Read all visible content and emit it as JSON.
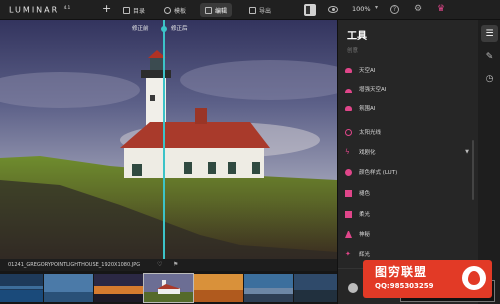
{
  "app": {
    "brand": "LUMINAR",
    "brand_version": "4.1"
  },
  "topbar": {
    "add_icon": "plus-icon",
    "catalog_label": "目录",
    "templates_label": "模板",
    "edit_label": "编辑",
    "export_label": "导出",
    "zoom_label": "100%",
    "help_label": "?"
  },
  "canvas": {
    "before_label": "修正前",
    "after_label": "修正后",
    "split_color": "#3cc3c8"
  },
  "file": {
    "name": "01241_GREGORYPOINTLIGHTHOUSE_1920X1080.JPG"
  },
  "filmstrip": {
    "selected_index": 2
  },
  "panel": {
    "title": "工具",
    "section": "创意",
    "tools": [
      {
        "label": "天空AI",
        "icon": "cloud",
        "has_caret": false
      },
      {
        "label": "增强天空AI",
        "icon": "half",
        "has_caret": false
      },
      {
        "label": "氛围AI",
        "icon": "cloud",
        "has_caret": false
      },
      {
        "label": "太阳光线",
        "icon": "sun",
        "has_caret": false
      },
      {
        "label": "戏剧化",
        "icon": "bolt",
        "has_caret": true
      },
      {
        "label": "颜色样式 (LUT)",
        "icon": "circle",
        "has_caret": false
      },
      {
        "label": "褪色",
        "icon": "square",
        "has_caret": false
      },
      {
        "label": "柔光",
        "icon": "square",
        "has_caret": false
      },
      {
        "label": "神秘",
        "icon": "tri",
        "has_caret": false
      },
      {
        "label": "辉光",
        "icon": "star",
        "has_caret": false
      }
    ],
    "accent_color": "#e0468a"
  },
  "watermark": {
    "title": "图穷联盟",
    "qq": "QQ:985303259"
  }
}
